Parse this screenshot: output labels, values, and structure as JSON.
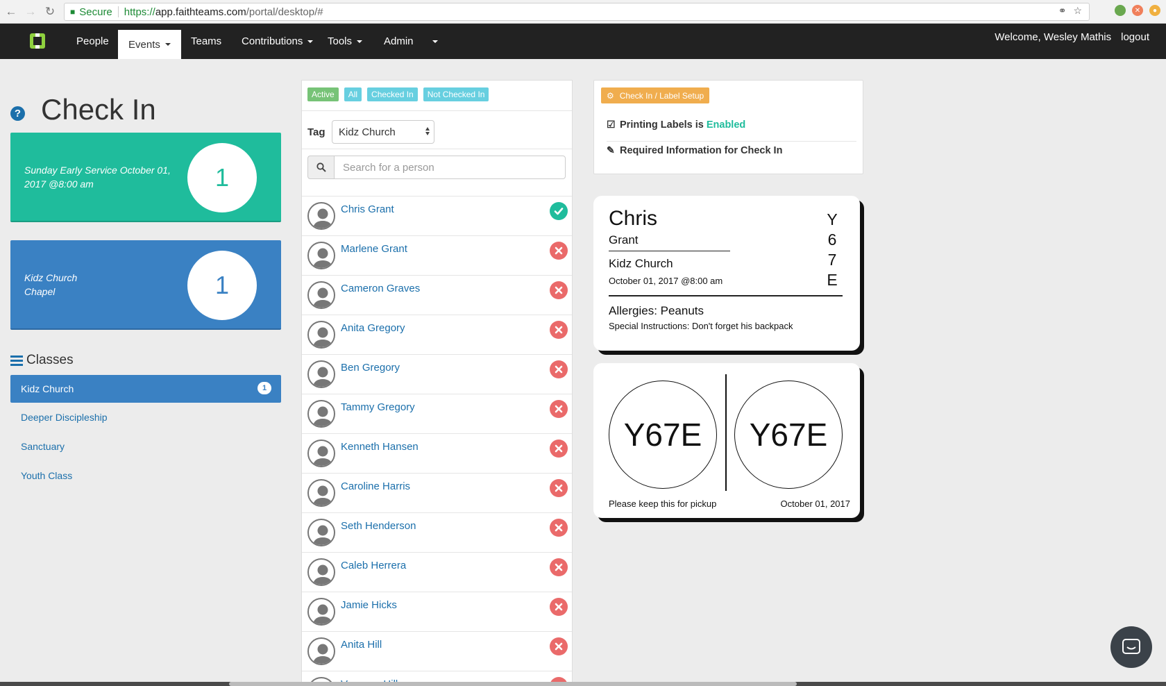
{
  "browser": {
    "secure_label": "Secure",
    "url_scheme": "https://",
    "url_host": "app.faithteams.com",
    "url_path": "/portal/desktop/#"
  },
  "navbar": {
    "items": [
      {
        "label": "People",
        "dropdown": false
      },
      {
        "label": "Events",
        "dropdown": true
      },
      {
        "label": "Teams",
        "dropdown": false
      },
      {
        "label": "Contributions",
        "dropdown": true
      },
      {
        "label": "Tools",
        "dropdown": true
      },
      {
        "label": "Admin",
        "dropdown": false
      }
    ],
    "active": "Events",
    "welcome": "Welcome, Wesley Mathis",
    "logout": "logout"
  },
  "page": {
    "title": "Check In"
  },
  "stats": [
    {
      "text_line1": "Sunday Early Service October 01,",
      "text_line2": "2017 @8:00 am",
      "count": "1",
      "color": "#1fbc9c"
    },
    {
      "text_line1": "Kidz Church",
      "text_line2": "Chapel",
      "count": "1",
      "color": "#3a81c3"
    }
  ],
  "classes": {
    "title": "Classes",
    "items": [
      {
        "label": "Kidz Church",
        "badge": "1",
        "active": true
      },
      {
        "label": "Deeper Discipleship",
        "badge": "",
        "active": false
      },
      {
        "label": "Sanctuary",
        "badge": "",
        "active": false
      },
      {
        "label": "Youth Class",
        "badge": "",
        "active": false
      }
    ]
  },
  "filters": [
    {
      "label": "Active",
      "color": "#77c377"
    },
    {
      "label": "All",
      "color": "#67cfe0"
    },
    {
      "label": "Checked In",
      "color": "#67cfe0"
    },
    {
      "label": "Not Checked In",
      "color": "#67cfe0"
    }
  ],
  "tag": {
    "label": "Tag",
    "selected": "Kidz Church"
  },
  "search": {
    "placeholder": "Search for a person"
  },
  "people": [
    {
      "name": "Chris Grant",
      "checked_in": true
    },
    {
      "name": "Marlene Grant",
      "checked_in": false
    },
    {
      "name": "Cameron Graves",
      "checked_in": false
    },
    {
      "name": "Anita Gregory",
      "checked_in": false
    },
    {
      "name": "Ben Gregory",
      "checked_in": false
    },
    {
      "name": "Tammy Gregory",
      "checked_in": false
    },
    {
      "name": "Kenneth Hansen",
      "checked_in": false
    },
    {
      "name": "Caroline Harris",
      "checked_in": false
    },
    {
      "name": "Seth Henderson",
      "checked_in": false
    },
    {
      "name": "Caleb Herrera",
      "checked_in": false
    },
    {
      "name": "Jamie Hicks",
      "checked_in": false
    },
    {
      "name": "Anita Hill",
      "checked_in": false
    },
    {
      "name": "Vanessa Hill",
      "checked_in": false
    }
  ],
  "setup": {
    "button": "Check In / Label Setup",
    "printing_prefix": "Printing Labels is",
    "printing_status": "Enabled",
    "required_info": "Required Information for Check In"
  },
  "name_label": {
    "first": "Chris",
    "last": "Grant",
    "class": "Kidz Church",
    "date": "October 01, 2017 @8:00 am",
    "code_chars": [
      "Y",
      "6",
      "7",
      "E"
    ],
    "allergies": "Allergies: Peanuts",
    "special": "Special Instructions: Don't forget his backpack"
  },
  "pickup_label": {
    "code": "Y67E",
    "note": "Please keep this for pickup",
    "date": "October 01, 2017"
  },
  "colors": {
    "navbar": "#222222",
    "link": "#1b6fab",
    "teal": "#1fbc9c",
    "blue": "#3a81c3",
    "danger": "#ea6a6a",
    "warning": "#f0ad4e"
  }
}
